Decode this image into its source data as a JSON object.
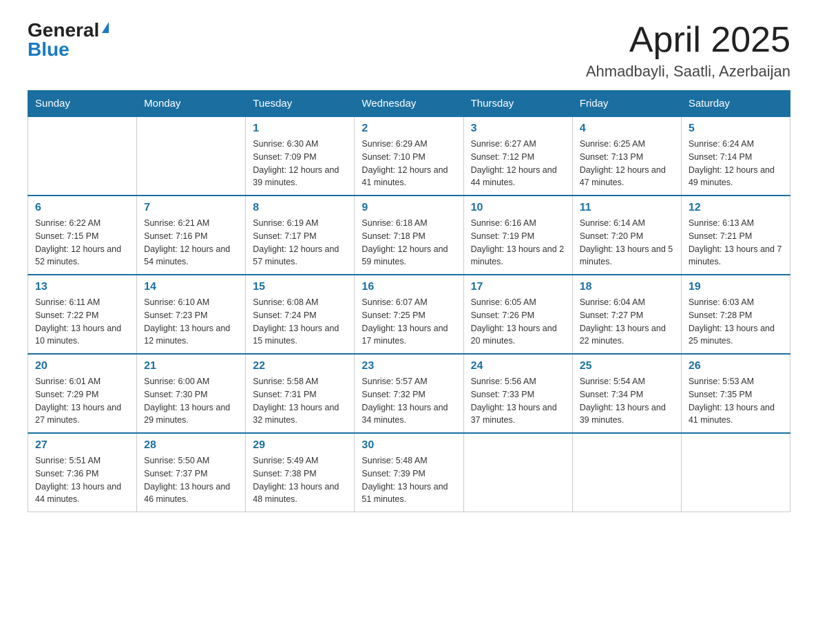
{
  "header": {
    "logo_general": "General",
    "logo_blue": "Blue",
    "month_title": "April 2025",
    "location": "Ahmadbayli, Saatli, Azerbaijan"
  },
  "weekdays": [
    "Sunday",
    "Monday",
    "Tuesday",
    "Wednesday",
    "Thursday",
    "Friday",
    "Saturday"
  ],
  "weeks": [
    [
      {
        "day": "",
        "sunrise": "",
        "sunset": "",
        "daylight": ""
      },
      {
        "day": "",
        "sunrise": "",
        "sunset": "",
        "daylight": ""
      },
      {
        "day": "1",
        "sunrise": "Sunrise: 6:30 AM",
        "sunset": "Sunset: 7:09 PM",
        "daylight": "Daylight: 12 hours and 39 minutes."
      },
      {
        "day": "2",
        "sunrise": "Sunrise: 6:29 AM",
        "sunset": "Sunset: 7:10 PM",
        "daylight": "Daylight: 12 hours and 41 minutes."
      },
      {
        "day": "3",
        "sunrise": "Sunrise: 6:27 AM",
        "sunset": "Sunset: 7:12 PM",
        "daylight": "Daylight: 12 hours and 44 minutes."
      },
      {
        "day": "4",
        "sunrise": "Sunrise: 6:25 AM",
        "sunset": "Sunset: 7:13 PM",
        "daylight": "Daylight: 12 hours and 47 minutes."
      },
      {
        "day": "5",
        "sunrise": "Sunrise: 6:24 AM",
        "sunset": "Sunset: 7:14 PM",
        "daylight": "Daylight: 12 hours and 49 minutes."
      }
    ],
    [
      {
        "day": "6",
        "sunrise": "Sunrise: 6:22 AM",
        "sunset": "Sunset: 7:15 PM",
        "daylight": "Daylight: 12 hours and 52 minutes."
      },
      {
        "day": "7",
        "sunrise": "Sunrise: 6:21 AM",
        "sunset": "Sunset: 7:16 PM",
        "daylight": "Daylight: 12 hours and 54 minutes."
      },
      {
        "day": "8",
        "sunrise": "Sunrise: 6:19 AM",
        "sunset": "Sunset: 7:17 PM",
        "daylight": "Daylight: 12 hours and 57 minutes."
      },
      {
        "day": "9",
        "sunrise": "Sunrise: 6:18 AM",
        "sunset": "Sunset: 7:18 PM",
        "daylight": "Daylight: 12 hours and 59 minutes."
      },
      {
        "day": "10",
        "sunrise": "Sunrise: 6:16 AM",
        "sunset": "Sunset: 7:19 PM",
        "daylight": "Daylight: 13 hours and 2 minutes."
      },
      {
        "day": "11",
        "sunrise": "Sunrise: 6:14 AM",
        "sunset": "Sunset: 7:20 PM",
        "daylight": "Daylight: 13 hours and 5 minutes."
      },
      {
        "day": "12",
        "sunrise": "Sunrise: 6:13 AM",
        "sunset": "Sunset: 7:21 PM",
        "daylight": "Daylight: 13 hours and 7 minutes."
      }
    ],
    [
      {
        "day": "13",
        "sunrise": "Sunrise: 6:11 AM",
        "sunset": "Sunset: 7:22 PM",
        "daylight": "Daylight: 13 hours and 10 minutes."
      },
      {
        "day": "14",
        "sunrise": "Sunrise: 6:10 AM",
        "sunset": "Sunset: 7:23 PM",
        "daylight": "Daylight: 13 hours and 12 minutes."
      },
      {
        "day": "15",
        "sunrise": "Sunrise: 6:08 AM",
        "sunset": "Sunset: 7:24 PM",
        "daylight": "Daylight: 13 hours and 15 minutes."
      },
      {
        "day": "16",
        "sunrise": "Sunrise: 6:07 AM",
        "sunset": "Sunset: 7:25 PM",
        "daylight": "Daylight: 13 hours and 17 minutes."
      },
      {
        "day": "17",
        "sunrise": "Sunrise: 6:05 AM",
        "sunset": "Sunset: 7:26 PM",
        "daylight": "Daylight: 13 hours and 20 minutes."
      },
      {
        "day": "18",
        "sunrise": "Sunrise: 6:04 AM",
        "sunset": "Sunset: 7:27 PM",
        "daylight": "Daylight: 13 hours and 22 minutes."
      },
      {
        "day": "19",
        "sunrise": "Sunrise: 6:03 AM",
        "sunset": "Sunset: 7:28 PM",
        "daylight": "Daylight: 13 hours and 25 minutes."
      }
    ],
    [
      {
        "day": "20",
        "sunrise": "Sunrise: 6:01 AM",
        "sunset": "Sunset: 7:29 PM",
        "daylight": "Daylight: 13 hours and 27 minutes."
      },
      {
        "day": "21",
        "sunrise": "Sunrise: 6:00 AM",
        "sunset": "Sunset: 7:30 PM",
        "daylight": "Daylight: 13 hours and 29 minutes."
      },
      {
        "day": "22",
        "sunrise": "Sunrise: 5:58 AM",
        "sunset": "Sunset: 7:31 PM",
        "daylight": "Daylight: 13 hours and 32 minutes."
      },
      {
        "day": "23",
        "sunrise": "Sunrise: 5:57 AM",
        "sunset": "Sunset: 7:32 PM",
        "daylight": "Daylight: 13 hours and 34 minutes."
      },
      {
        "day": "24",
        "sunrise": "Sunrise: 5:56 AM",
        "sunset": "Sunset: 7:33 PM",
        "daylight": "Daylight: 13 hours and 37 minutes."
      },
      {
        "day": "25",
        "sunrise": "Sunrise: 5:54 AM",
        "sunset": "Sunset: 7:34 PM",
        "daylight": "Daylight: 13 hours and 39 minutes."
      },
      {
        "day": "26",
        "sunrise": "Sunrise: 5:53 AM",
        "sunset": "Sunset: 7:35 PM",
        "daylight": "Daylight: 13 hours and 41 minutes."
      }
    ],
    [
      {
        "day": "27",
        "sunrise": "Sunrise: 5:51 AM",
        "sunset": "Sunset: 7:36 PM",
        "daylight": "Daylight: 13 hours and 44 minutes."
      },
      {
        "day": "28",
        "sunrise": "Sunrise: 5:50 AM",
        "sunset": "Sunset: 7:37 PM",
        "daylight": "Daylight: 13 hours and 46 minutes."
      },
      {
        "day": "29",
        "sunrise": "Sunrise: 5:49 AM",
        "sunset": "Sunset: 7:38 PM",
        "daylight": "Daylight: 13 hours and 48 minutes."
      },
      {
        "day": "30",
        "sunrise": "Sunrise: 5:48 AM",
        "sunset": "Sunset: 7:39 PM",
        "daylight": "Daylight: 13 hours and 51 minutes."
      },
      {
        "day": "",
        "sunrise": "",
        "sunset": "",
        "daylight": ""
      },
      {
        "day": "",
        "sunrise": "",
        "sunset": "",
        "daylight": ""
      },
      {
        "day": "",
        "sunrise": "",
        "sunset": "",
        "daylight": ""
      }
    ]
  ]
}
